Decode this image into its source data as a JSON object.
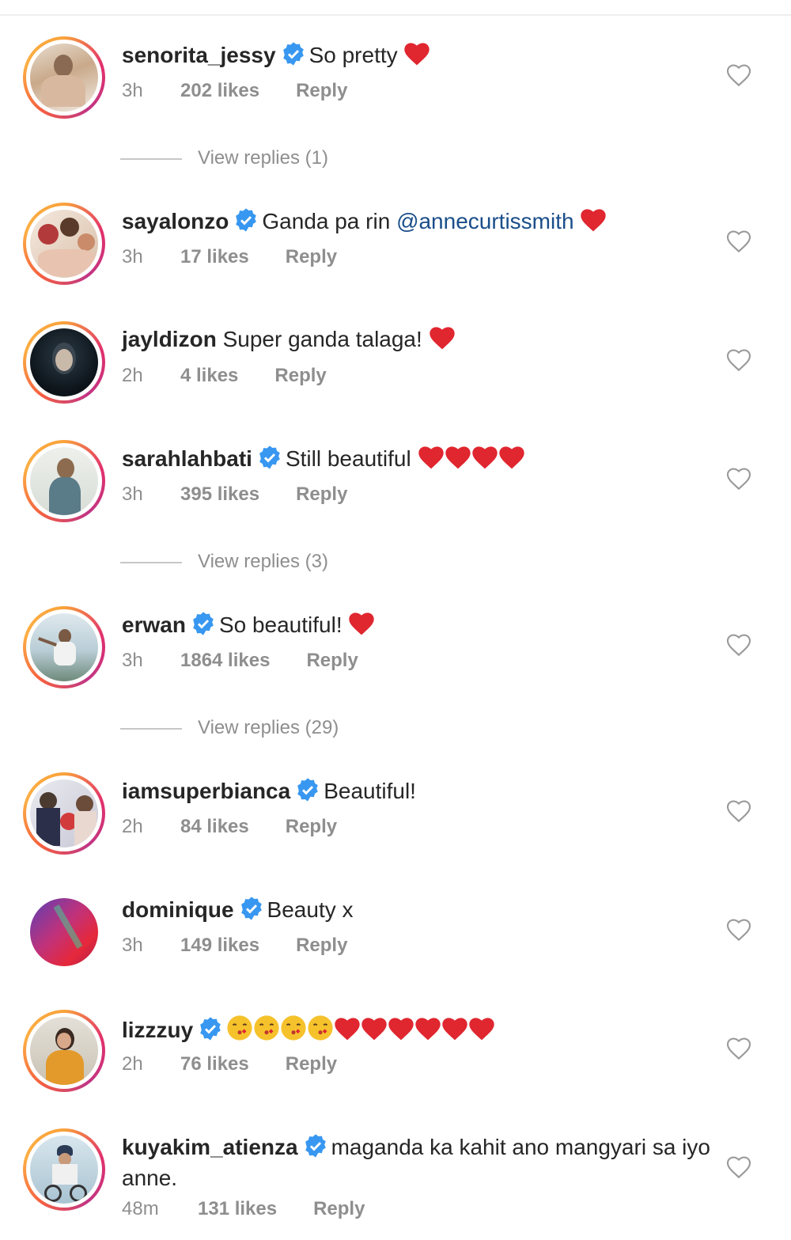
{
  "comments": [
    {
      "username": "senorita_jessy",
      "verified": true,
      "text": "So pretty",
      "emoji_after": "red-heart",
      "time": "3h",
      "likes": "202 likes",
      "reply": "Reply",
      "view_replies": "View replies (1)"
    },
    {
      "username": "sayalonzo",
      "verified": true,
      "text": "Ganda pa rin ",
      "mention": "@annecurtissmith",
      "emoji_after": "red-heart",
      "time": "3h",
      "likes": "17 likes",
      "reply": "Reply"
    },
    {
      "username": "jayldizon",
      "verified": false,
      "text": "Super ganda talaga!",
      "emoji_after": "red-heart",
      "time": "2h",
      "likes": "4 likes",
      "reply": "Reply"
    },
    {
      "username": "sarahlahbati",
      "verified": true,
      "text": "Still beautiful",
      "emoji_after": "red-heart x4",
      "time": "3h",
      "likes": "395 likes",
      "reply": "Reply",
      "view_replies": "View replies (3)"
    },
    {
      "username": "erwan",
      "verified": true,
      "text": "So beautiful!",
      "emoji_after": "red-heart",
      "time": "3h",
      "likes": "1864 likes",
      "reply": "Reply",
      "view_replies": "View replies (29)"
    },
    {
      "username": "iamsuperbianca",
      "verified": true,
      "text": "Beautiful!",
      "time": "2h",
      "likes": "84 likes",
      "reply": "Reply"
    },
    {
      "username": "dominique",
      "verified": true,
      "text": "Beauty x",
      "time": "3h",
      "likes": "149 likes",
      "reply": "Reply"
    },
    {
      "username": "lizzzuy",
      "verified": true,
      "text": "",
      "emoji_after": "kissing-face x4, red-heart x6",
      "time": "2h",
      "likes": "76 likes",
      "reply": "Reply"
    },
    {
      "username": "kuyakim_atienza",
      "verified": true,
      "text": "maganda ka kahit ano mangyari sa iyo anne.",
      "time": "48m",
      "likes": "131 likes",
      "reply": "Reply"
    }
  ],
  "colors": {
    "verified": "#3897f0",
    "heart": "#e0262f",
    "meta": "#8e8e8e",
    "mention": "#1a4e8a"
  }
}
